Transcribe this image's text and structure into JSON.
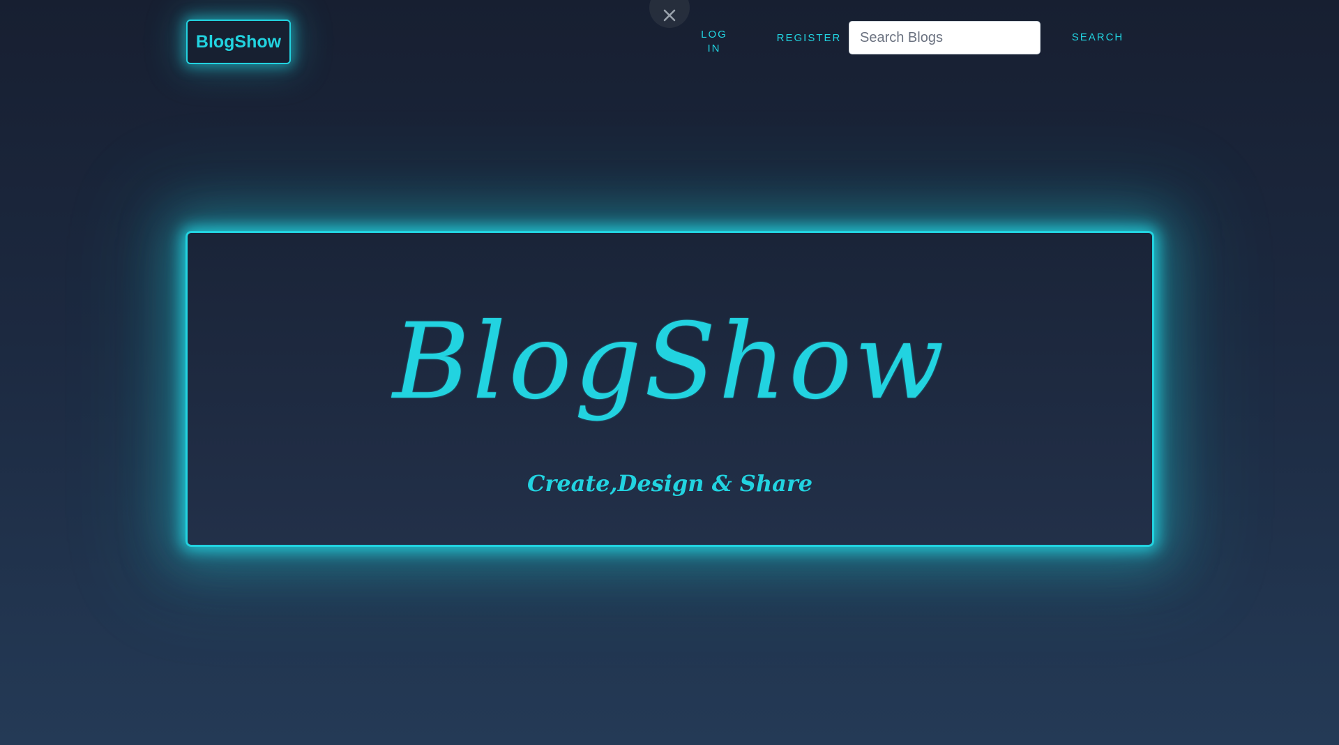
{
  "overlay": {
    "close_icon": "close-icon"
  },
  "header": {
    "brand_label": "BlogShow",
    "nav": {
      "login_line1": "LOG",
      "login_line2": "IN",
      "register_label": "REGISTER",
      "search_placeholder": "Search Blogs",
      "search_value": "",
      "search_button_label": "SEARCH"
    }
  },
  "hero": {
    "title": "BlogShow",
    "tagline": "Create,Design & Share"
  },
  "colors": {
    "accent": "#22d3e0",
    "background_top": "#171f31",
    "background_bottom": "#243a56",
    "panel": "#1c283e"
  }
}
